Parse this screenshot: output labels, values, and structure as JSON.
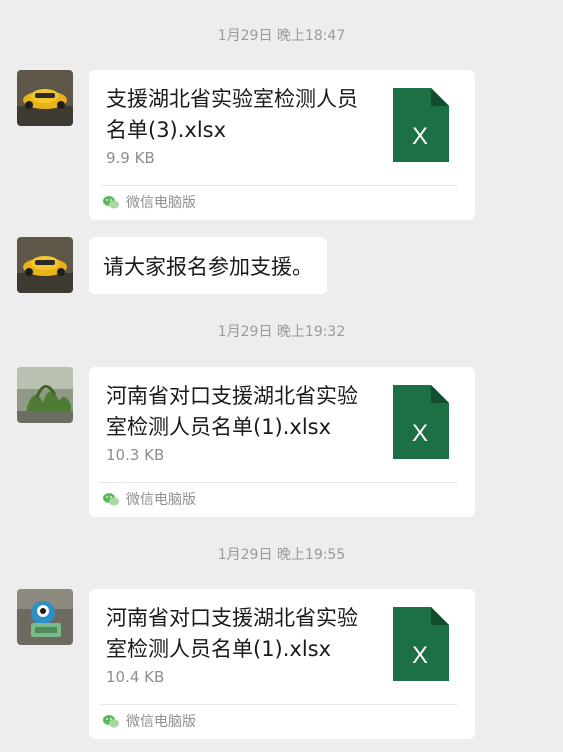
{
  "timestamps": [
    "1月29日 晚上18:47",
    "1月29日 晚上19:32",
    "1月29日 晚上19:55"
  ],
  "messages": [
    {
      "file_name": "支援湖北省实验室检测人员名单(3).xlsx",
      "file_size": "9.9 KB",
      "source": "微信电脑版"
    },
    {
      "text": "请大家报名参加支援。"
    },
    {
      "file_name": "河南省对口支援湖北省实验室检测人员名单(1).xlsx",
      "file_size": "10.3 KB",
      "source": "微信电脑版"
    },
    {
      "file_name": "河南省对口支援湖北省实验室检测人员名单(1).xlsx",
      "file_size": "10.4 KB",
      "source": "微信电脑版"
    }
  ],
  "file_icon_letter": "X",
  "colors": {
    "excel_green": "#1d7044",
    "excel_fold": "#124d2d",
    "wechat_green": "#5bb85b"
  },
  "icons": {
    "file": "excel-file-icon",
    "source": "wechat-logo-icon"
  }
}
